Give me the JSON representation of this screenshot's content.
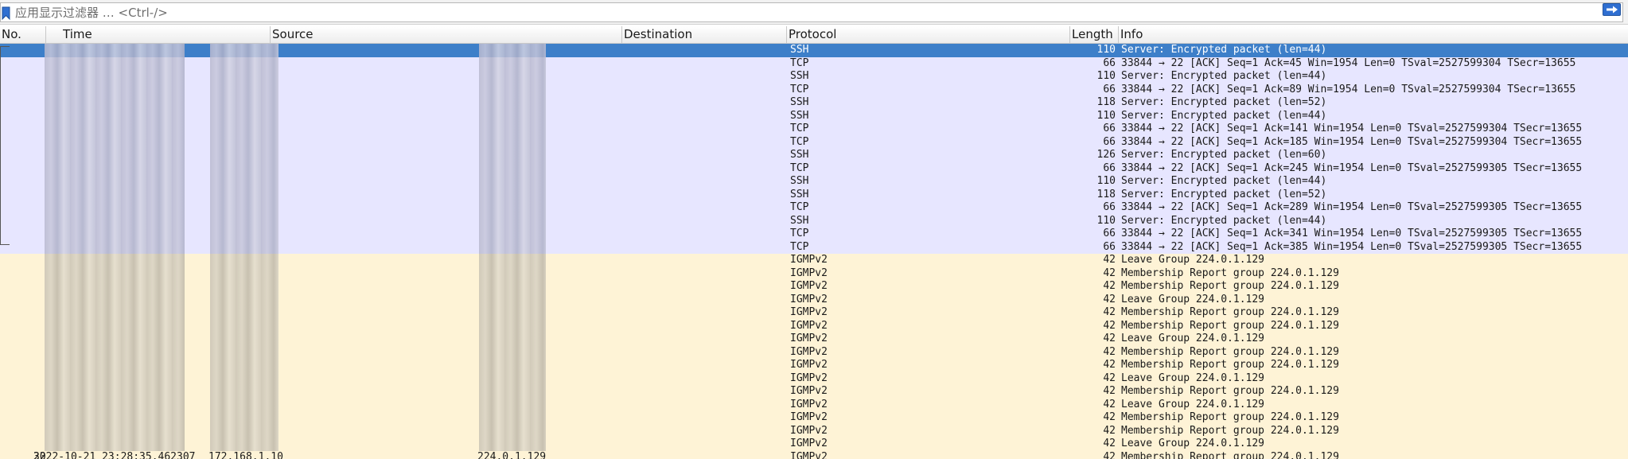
{
  "filter": {
    "placeholder": "应用显示过滤器 … <Ctrl-/>"
  },
  "icons": {
    "bookmark": "bookmark-icon",
    "apply": "arrow-right-icon"
  },
  "colors": {
    "ssh_row": "#e7e6ff",
    "igmp_row": "#fef3d6",
    "selected_row": "#3d7fc9",
    "apply_button": "#2f6fd1"
  },
  "columns": {
    "no": "No.",
    "time": "Time",
    "source": "Source",
    "destination": "Destination",
    "protocol": "Protocol",
    "length": "Length",
    "info": "Info"
  },
  "packets": [
    {
      "protocol": "SSH",
      "length": "110",
      "info": "Server: Encrypted packet (len=44)"
    },
    {
      "protocol": "TCP",
      "length": "66",
      "info": "33844 → 22 [ACK] Seq=1 Ack=45 Win=1954 Len=0 TSval=2527599304 TSecr=13655"
    },
    {
      "protocol": "SSH",
      "length": "110",
      "info": "Server: Encrypted packet (len=44)"
    },
    {
      "protocol": "TCP",
      "length": "66",
      "info": "33844 → 22 [ACK] Seq=1 Ack=89 Win=1954 Len=0 TSval=2527599304 TSecr=13655"
    },
    {
      "protocol": "SSH",
      "length": "118",
      "info": "Server: Encrypted packet (len=52)"
    },
    {
      "protocol": "SSH",
      "length": "110",
      "info": "Server: Encrypted packet (len=44)"
    },
    {
      "protocol": "TCP",
      "length": "66",
      "info": "33844 → 22 [ACK] Seq=1 Ack=141 Win=1954 Len=0 TSval=2527599304 TSecr=13655"
    },
    {
      "protocol": "TCP",
      "length": "66",
      "info": "33844 → 22 [ACK] Seq=1 Ack=185 Win=1954 Len=0 TSval=2527599304 TSecr=13655"
    },
    {
      "protocol": "SSH",
      "length": "126",
      "info": "Server: Encrypted packet (len=60)"
    },
    {
      "protocol": "TCP",
      "length": "66",
      "info": "33844 → 22 [ACK] Seq=1 Ack=245 Win=1954 Len=0 TSval=2527599305 TSecr=13655"
    },
    {
      "protocol": "SSH",
      "length": "110",
      "info": "Server: Encrypted packet (len=44)"
    },
    {
      "protocol": "SSH",
      "length": "118",
      "info": "Server: Encrypted packet (len=52)"
    },
    {
      "protocol": "TCP",
      "length": "66",
      "info": "33844 → 22 [ACK] Seq=1 Ack=289 Win=1954 Len=0 TSval=2527599305 TSecr=13655"
    },
    {
      "protocol": "SSH",
      "length": "110",
      "info": "Server: Encrypted packet (len=44)"
    },
    {
      "protocol": "TCP",
      "length": "66",
      "info": "33844 → 22 [ACK] Seq=1 Ack=341 Win=1954 Len=0 TSval=2527599305 TSecr=13655"
    },
    {
      "protocol": "TCP",
      "length": "66",
      "info": "33844 → 22 [ACK] Seq=1 Ack=385 Win=1954 Len=0 TSval=2527599305 TSecr=13655"
    },
    {
      "protocol": "IGMPv2",
      "length": "42",
      "info": "Leave Group 224.0.1.129"
    },
    {
      "protocol": "IGMPv2",
      "length": "42",
      "info": "Membership Report group 224.0.1.129"
    },
    {
      "protocol": "IGMPv2",
      "length": "42",
      "info": "Membership Report group 224.0.1.129"
    },
    {
      "protocol": "IGMPv2",
      "length": "42",
      "info": "Leave Group 224.0.1.129"
    },
    {
      "protocol": "IGMPv2",
      "length": "42",
      "info": "Membership Report group 224.0.1.129"
    },
    {
      "protocol": "IGMPv2",
      "length": "42",
      "info": "Membership Report group 224.0.1.129"
    },
    {
      "protocol": "IGMPv2",
      "length": "42",
      "info": "Leave Group 224.0.1.129"
    },
    {
      "protocol": "IGMPv2",
      "length": "42",
      "info": "Membership Report group 224.0.1.129"
    },
    {
      "protocol": "IGMPv2",
      "length": "42",
      "info": "Membership Report group 224.0.1.129"
    },
    {
      "protocol": "IGMPv2",
      "length": "42",
      "info": "Leave Group 224.0.1.129"
    },
    {
      "protocol": "IGMPv2",
      "length": "42",
      "info": "Membership Report group 224.0.1.129"
    },
    {
      "protocol": "IGMPv2",
      "length": "42",
      "info": "Leave Group 224.0.1.129"
    },
    {
      "protocol": "IGMPv2",
      "length": "42",
      "info": "Membership Report group 224.0.1.129"
    },
    {
      "protocol": "IGMPv2",
      "length": "42",
      "info": "Membership Report group 224.0.1.129"
    },
    {
      "protocol": "IGMPv2",
      "length": "42",
      "info": "Leave Group 224.0.1.129"
    },
    {
      "no": "32",
      "time": "2022-10-21 23:28:35.462307",
      "source": "172.168.1.10",
      "destination": "224.0.1.129",
      "protocol": "IGMPv2",
      "length": "42",
      "info": "Membership Report group 224.0.1.129"
    }
  ]
}
